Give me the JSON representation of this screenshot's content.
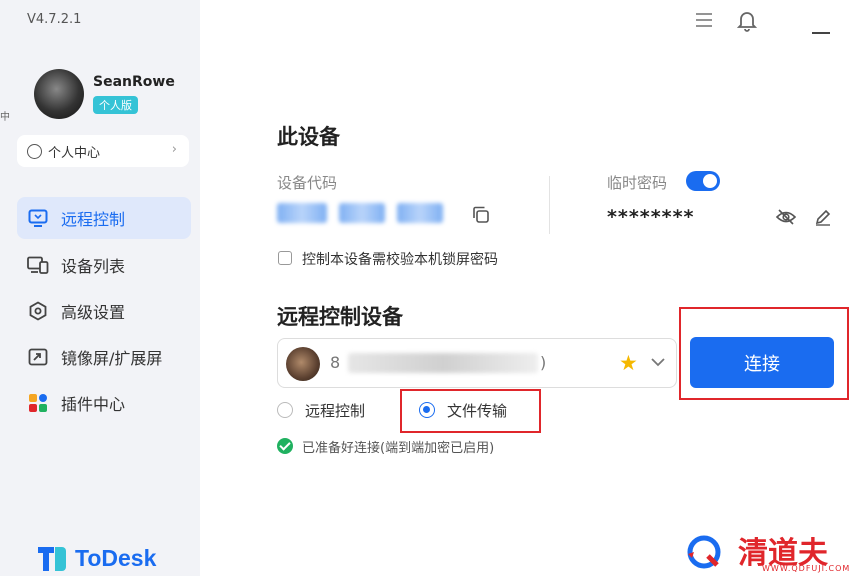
{
  "app": {
    "version": "V4.7.2.1",
    "stray_char": "中"
  },
  "user": {
    "name": "SeanRowe",
    "plan": "个人版"
  },
  "profile": {
    "label": "个人中心"
  },
  "nav": {
    "items": [
      {
        "label": "远程控制",
        "icon": "monitor-icon"
      },
      {
        "label": "设备列表",
        "icon": "devices-icon"
      },
      {
        "label": "高级设置",
        "icon": "settings-icon"
      },
      {
        "label": "镜像屏/扩展屏",
        "icon": "mirror-screen-icon"
      },
      {
        "label": "插件中心",
        "icon": "plugin-icon"
      }
    ],
    "active_index": 0
  },
  "brand": {
    "name": "ToDesk"
  },
  "this_device": {
    "title": "此设备",
    "code_label": "设备代码",
    "temp_password_label": "临时密码",
    "temp_password_enabled": true,
    "password": "********",
    "lock_check_label": "控制本设备需校验本机锁屏密码",
    "lock_check_checked": false
  },
  "remote": {
    "title": "远程控制设备",
    "device_text": "8",
    "device_text_end": ")",
    "favorite": true,
    "connect_label": "连接",
    "modes": [
      {
        "label": "远程控制",
        "selected": false
      },
      {
        "label": "文件传输",
        "selected": true
      }
    ],
    "status": "已准备好连接(端到端加密已启用)"
  },
  "watermark": {
    "text": "清道夫",
    "url": "WWW.QDFUJI.COM"
  },
  "colors": {
    "accent": "#1a6cf0",
    "highlight": "#e0262b",
    "success": "#20b160"
  }
}
